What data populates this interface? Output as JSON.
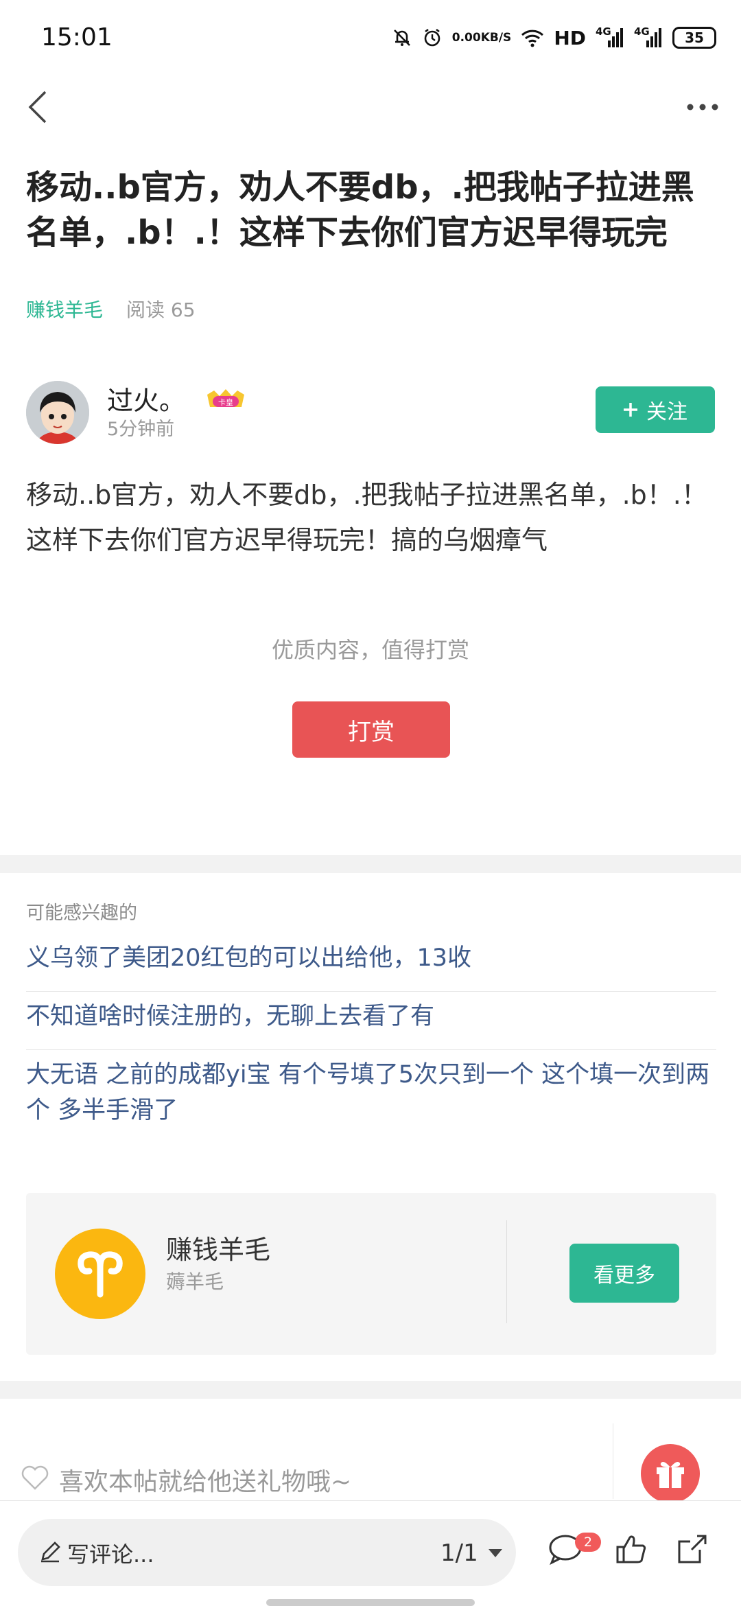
{
  "status_bar": {
    "time": "15:01",
    "net_speed_value": "0.00",
    "net_speed_unit": "KB/S",
    "hd_label": "HD",
    "signal1_label": "4G",
    "signal2_label": "4G",
    "battery": "35"
  },
  "post": {
    "title": "移动..b官方，劝人不要db，.把我帖子拉进黑名单，.b！.！这样下去你们官方迟早得玩完",
    "tag": "赚钱羊毛",
    "reads": "阅读 65",
    "author": {
      "name": "过火。",
      "badge_text": "卡皇",
      "time": "5分钟前",
      "follow_label": "关注"
    },
    "body": "移动..b官方，劝人不要db，.把我帖子拉进黑名单，.b！.！这样下去你们官方迟早得玩完！搞的乌烟瘴气",
    "reward_hint": "优质内容，值得打赏",
    "reward_label": "打赏"
  },
  "related": {
    "title": "可能感兴趣的",
    "items": [
      "义乌领了美团20红包的可以出给他，13收",
      "不知道啥时候注册的，无聊上去看了有",
      "大无语 之前的成都yi宝 有个号填了5次只到一个 这个填一次到两个 多半手滑了"
    ]
  },
  "forum": {
    "name": "赚钱羊毛",
    "subtitle": "薅羊毛",
    "more_label": "看更多"
  },
  "gift": {
    "text": "喜欢本帖就给他送礼物哦~"
  },
  "bottom_bar": {
    "comment_placeholder": "写评论...",
    "page_indicator": "1/1",
    "comment_count": "2"
  },
  "colors": {
    "accent": "#2db793",
    "reward": "#e85455",
    "link": "#3e5a8a",
    "forum_logo": "#fbb710"
  }
}
